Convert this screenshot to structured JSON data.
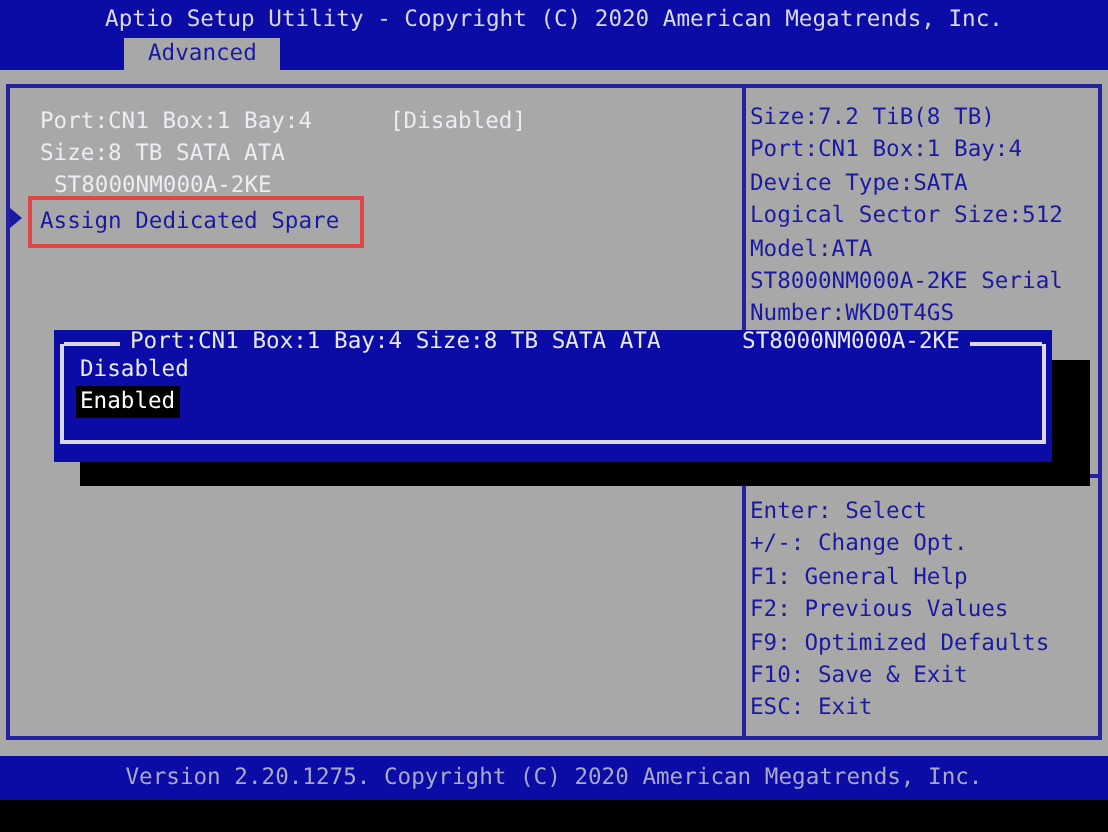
{
  "header": {
    "title": "Aptio Setup Utility - Copyright (C) 2020 American Megatrends, Inc.",
    "tabs": [
      {
        "label": "Advanced",
        "selected": true
      }
    ]
  },
  "settings": [
    {
      "kind": "option",
      "label": "Port:CN1 Box:1 Bay:4",
      "value": "[Disabled]"
    },
    {
      "kind": "text",
      "label": "Size:8 TB SATA ATA"
    },
    {
      "kind": "indented",
      "label": "ST8000NM000A-2KE"
    },
    {
      "kind": "submenu",
      "label": "Assign Dedicated Spare",
      "highlighted": true
    }
  ],
  "help": [
    "Size:7.2 TiB(8 TB)",
    "Port:CN1 Box:1 Bay:4",
    "Device Type:SATA",
    "Logical Sector Size:512",
    "Model:ATA",
    "ST8000NM000A-2KE Serial",
    "Number:WKD0T4GS"
  ],
  "keys": [
    "Enter: Select",
    "+/-: Change Opt.",
    "F1: General Help",
    "F2: Previous Values",
    "F9: Optimized Defaults",
    "F10: Save & Exit",
    "ESC: Exit"
  ],
  "popup": {
    "title": "Port:CN1 Box:1 Bay:4 Size:8 TB SATA ATA      ST8000NM000A-2KE",
    "options": [
      {
        "label": "Disabled",
        "selected": false
      },
      {
        "label": "Enabled",
        "selected": true
      }
    ]
  },
  "footer": "Version 2.20.1275. Copyright (C) 2020 American Megatrends, Inc."
}
